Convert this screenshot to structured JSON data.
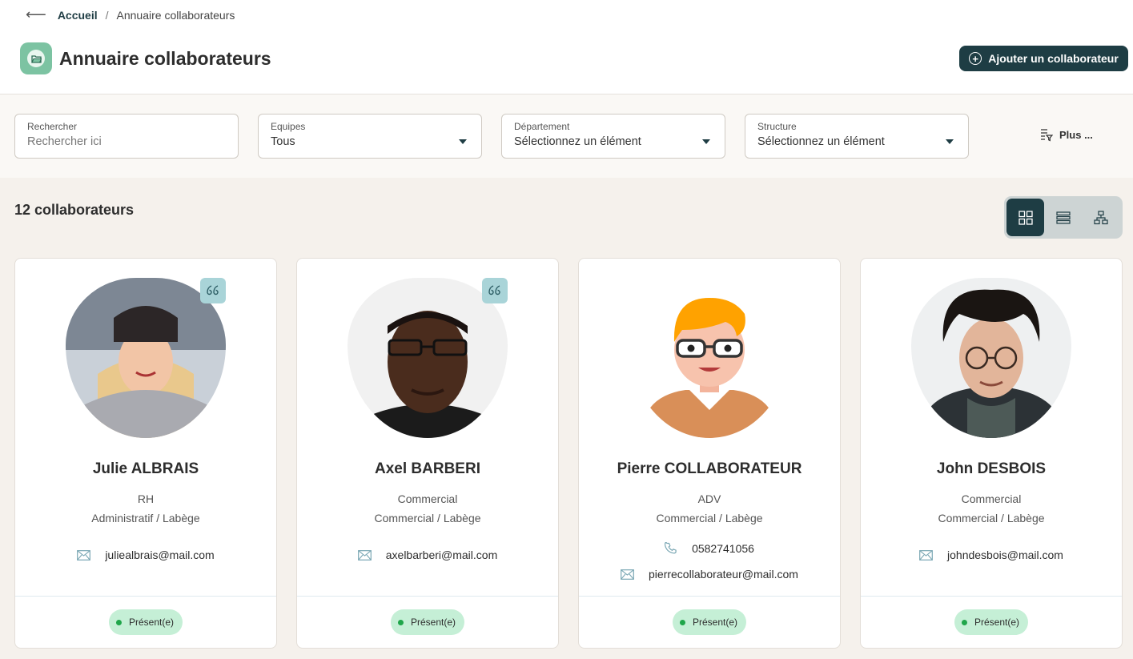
{
  "breadcrumb": {
    "home": "Accueil",
    "separator": "/",
    "current": "Annuaire collaborateurs"
  },
  "header": {
    "title": "Annuaire collaborateurs",
    "add_button": "Ajouter un collaborateur"
  },
  "filters": {
    "search": {
      "label": "Rechercher",
      "placeholder": "Rechercher ici"
    },
    "teams": {
      "label": "Equipes",
      "value": "Tous"
    },
    "department": {
      "label": "Département",
      "value": "Sélectionnez un élément"
    },
    "structure": {
      "label": "Structure",
      "value": "Sélectionnez un élément"
    },
    "more": "Plus ..."
  },
  "results": {
    "count_label": "12 collaborateurs"
  },
  "views": [
    "grid-view",
    "list-view",
    "org-chart-view"
  ],
  "colors": {
    "accent": "#1e3d44",
    "status_bg": "#c5efd6",
    "status_dot": "#1fa64a",
    "app_icon": "#7cc3a2"
  },
  "employees": [
    {
      "name": "Julie ALBRAIS",
      "role": "RH",
      "dept": "Administratif / Labège",
      "phone": "",
      "email": "juliealbrais@mail.com",
      "status": "Présent(e)",
      "has_quote": true
    },
    {
      "name": "Axel BARBERI",
      "role": "Commercial",
      "dept": "Commercial / Labège",
      "phone": "",
      "email": "axelbarberi@mail.com",
      "status": "Présent(e)",
      "has_quote": true
    },
    {
      "name": "Pierre COLLABORATEUR",
      "role": "ADV",
      "dept": "Commercial / Labège",
      "phone": "0582741056",
      "email": "pierrecollaborateur@mail.com",
      "status": "Présent(e)",
      "has_quote": false
    },
    {
      "name": "John DESBOIS",
      "role": "Commercial",
      "dept": "Commercial / Labège",
      "phone": "",
      "email": "johndesbois@mail.com",
      "status": "Présent(e)",
      "has_quote": false
    }
  ]
}
